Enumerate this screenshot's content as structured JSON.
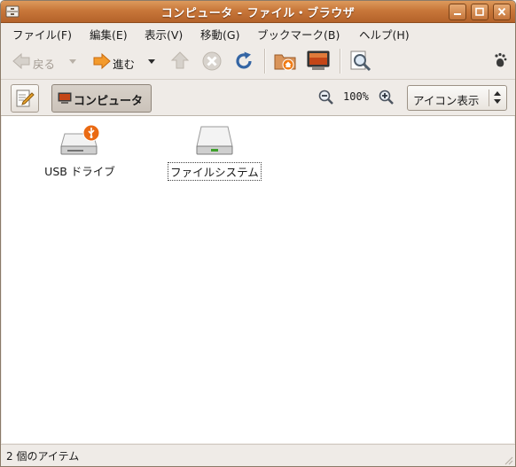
{
  "window": {
    "title": "コンピュータ - ファイル・ブラウザ",
    "controls": [
      "minimize-icon",
      "maximize-icon",
      "close-icon"
    ]
  },
  "menubar": {
    "items": [
      {
        "label": "ファイル(F)"
      },
      {
        "label": "編集(E)"
      },
      {
        "label": "表示(V)"
      },
      {
        "label": "移動(G)"
      },
      {
        "label": "ブックマーク(B)"
      },
      {
        "label": "ヘルプ(H)"
      }
    ]
  },
  "toolbar": {
    "back_label": "戻る",
    "forward_label": "進む",
    "icons": [
      "back-arrow-icon",
      "dropdown-arrow-icon",
      "forward-arrow-icon",
      "up-arrow-icon",
      "stop-icon",
      "reload-icon",
      "home-folder-icon",
      "computer-icon",
      "search-icon",
      "throbber-icon"
    ]
  },
  "locationbar": {
    "path_label": "コンピュータ",
    "zoom_value": "100%",
    "view_mode": "アイコン表示"
  },
  "content": {
    "items": [
      {
        "label": "USB ドライブ",
        "icon": "usb-drive-icon",
        "selected": false
      },
      {
        "label": "ファイルシステム",
        "icon": "hard-drive-icon",
        "selected": true
      }
    ]
  },
  "status": {
    "text": "2 個のアイテム"
  },
  "colors": {
    "titlebar_accent": "#c8773a",
    "window_background": "#efebe7",
    "forward_arrow": "#f08a1c",
    "reload_blue": "#3465a4"
  }
}
